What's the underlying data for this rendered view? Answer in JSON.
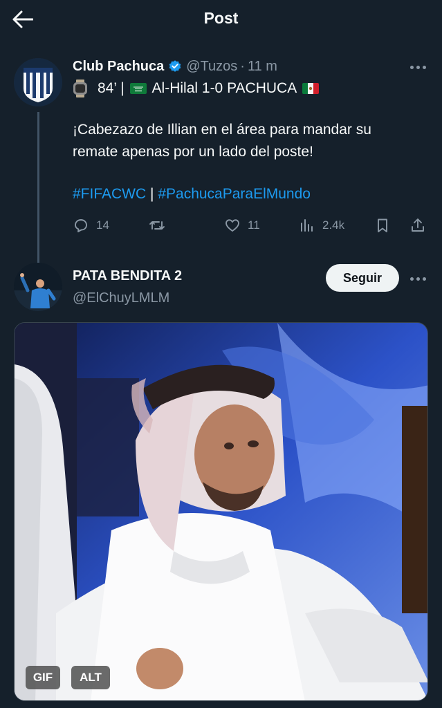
{
  "header": {
    "title": "Post",
    "back_icon": "arrow-left-icon"
  },
  "post": {
    "author_name": "Club Pachuca",
    "verified": true,
    "handle": "@Tuzos",
    "dot": "·",
    "time": "11 m",
    "score": {
      "watch_icon": "smartwatch-icon",
      "minute": "84’ |",
      "flag1": "saudi-arabia-flag",
      "match": "Al-Hilal 1-0 PACHUCA",
      "flag2": "mexico-flag"
    },
    "text": "¡Cabezazo de Illian en el área para mandar su remate apenas por un lado del poste!",
    "hashtags": [
      "#FIFACWC",
      "#PachucaParaElMundo"
    ],
    "separator": "|",
    "actions": {
      "replies": "14",
      "retweets": "",
      "likes": "11",
      "views": "2.4k"
    }
  },
  "reply": {
    "author_name": "PATA BENDITA 2",
    "handle": "@ElChuyLMLM",
    "follow_label": "Seguir",
    "media": {
      "gif_badge": "GIF",
      "alt_badge": "ALT"
    }
  },
  "colors": {
    "background": "#15202b",
    "accent": "#1d9bf0",
    "muted": "#8b98a5"
  }
}
